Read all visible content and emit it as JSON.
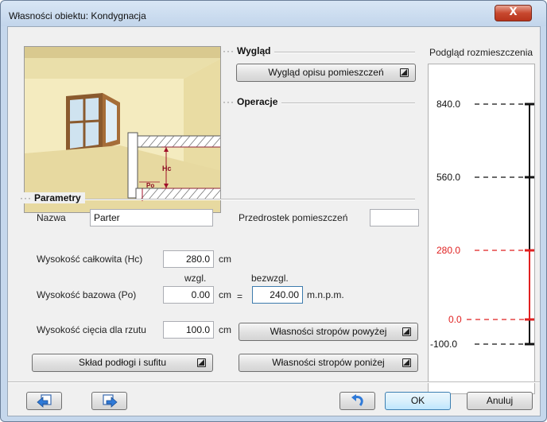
{
  "window": {
    "title": "Własności obiektu: Kondygnacja",
    "close_label": "X"
  },
  "appearance": {
    "header": "Wygląd",
    "button": "Wygląd opisu pomieszczeń"
  },
  "operations": {
    "header": "Operacje"
  },
  "image_labels": {
    "hc": "Hc",
    "po": "Po"
  },
  "parameters": {
    "header": "Parametry",
    "name_label": "Nazwa",
    "name_value": "Parter",
    "prefix_label": "Przedrostek pomieszczeń",
    "prefix_value": "",
    "total_height_label": "Wysokość całkowita (Hc)",
    "total_height_value": "280.0",
    "unit_cm": "cm",
    "relative_label": "wzgl.",
    "absolute_label": "bezwzgl.",
    "base_height_label": "Wysokość bazowa (Po)",
    "base_height_value": "0.00",
    "equals": "=",
    "absolute_value": "240.00",
    "absolute_unit": "m.n.p.m.",
    "cut_height_label": "Wysokość cięcia dla rzutu",
    "cut_height_value": "100.0",
    "ceiling_above_button": "Własności stropów powyżej",
    "ceiling_below_button": "Własności stropów poniżej",
    "floor_ceiling_button": "Skład podłogi i sufitu"
  },
  "layout_preview": {
    "title": "Podgląd rozmieszczenia",
    "levels": [
      {
        "label": "840.0",
        "color": "#1a1a1a",
        "current": false
      },
      {
        "label": "560.0",
        "color": "#1a1a1a",
        "current": false
      },
      {
        "label": "280.0",
        "color": "#e02020",
        "current": true
      },
      {
        "label": "0.0",
        "color": "#e02020",
        "current": true
      },
      {
        "label": "-100.0",
        "color": "#1a1a1a",
        "current": false
      }
    ]
  },
  "footer": {
    "ok": "OK",
    "cancel": "Anuluj",
    "prev_icon": "import-arrow-icon",
    "next_icon": "export-arrow-icon",
    "undo_icon": "undo-icon"
  },
  "colors": {
    "accent_red": "#e02020",
    "title_bg": "#c5d7ec",
    "close_red": "#c8482f"
  }
}
